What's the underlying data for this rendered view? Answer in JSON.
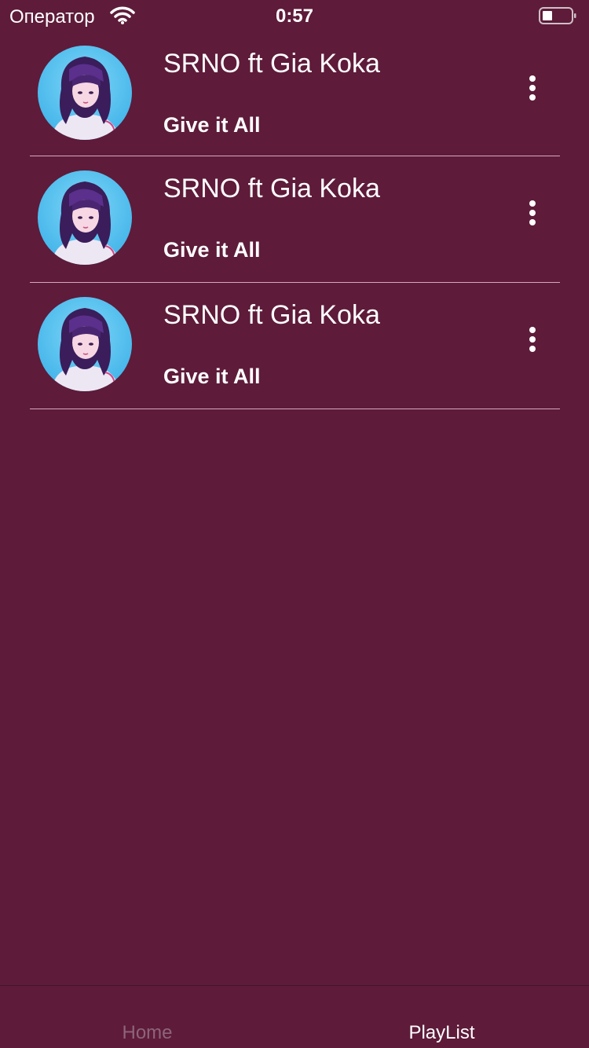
{
  "status_bar": {
    "carrier": "Оператор",
    "time": "0:57",
    "wifi_icon": "wifi-icon",
    "battery_icon": "battery-icon"
  },
  "tracks": [
    {
      "artist": "SRNO ft Gia Koka",
      "title": "Give it All",
      "avatar_icon": "anime-girl-avatar",
      "more_icon": "more-vertical-icon"
    },
    {
      "artist": "SRNO ft Gia Koka",
      "title": "Give it All",
      "avatar_icon": "anime-girl-avatar",
      "more_icon": "more-vertical-icon"
    },
    {
      "artist": "SRNO ft Gia Koka",
      "title": "Give it All",
      "avatar_icon": "anime-girl-avatar",
      "more_icon": "more-vertical-icon"
    }
  ],
  "tab_bar": {
    "tabs": [
      {
        "label": "Home",
        "active": false
      },
      {
        "label": "PlayList",
        "active": true
      }
    ]
  },
  "colors": {
    "background": "#5e1b3a",
    "text": "#ffffff",
    "inactive_tab": "#8d6578",
    "divider": "#d6a8bd"
  }
}
